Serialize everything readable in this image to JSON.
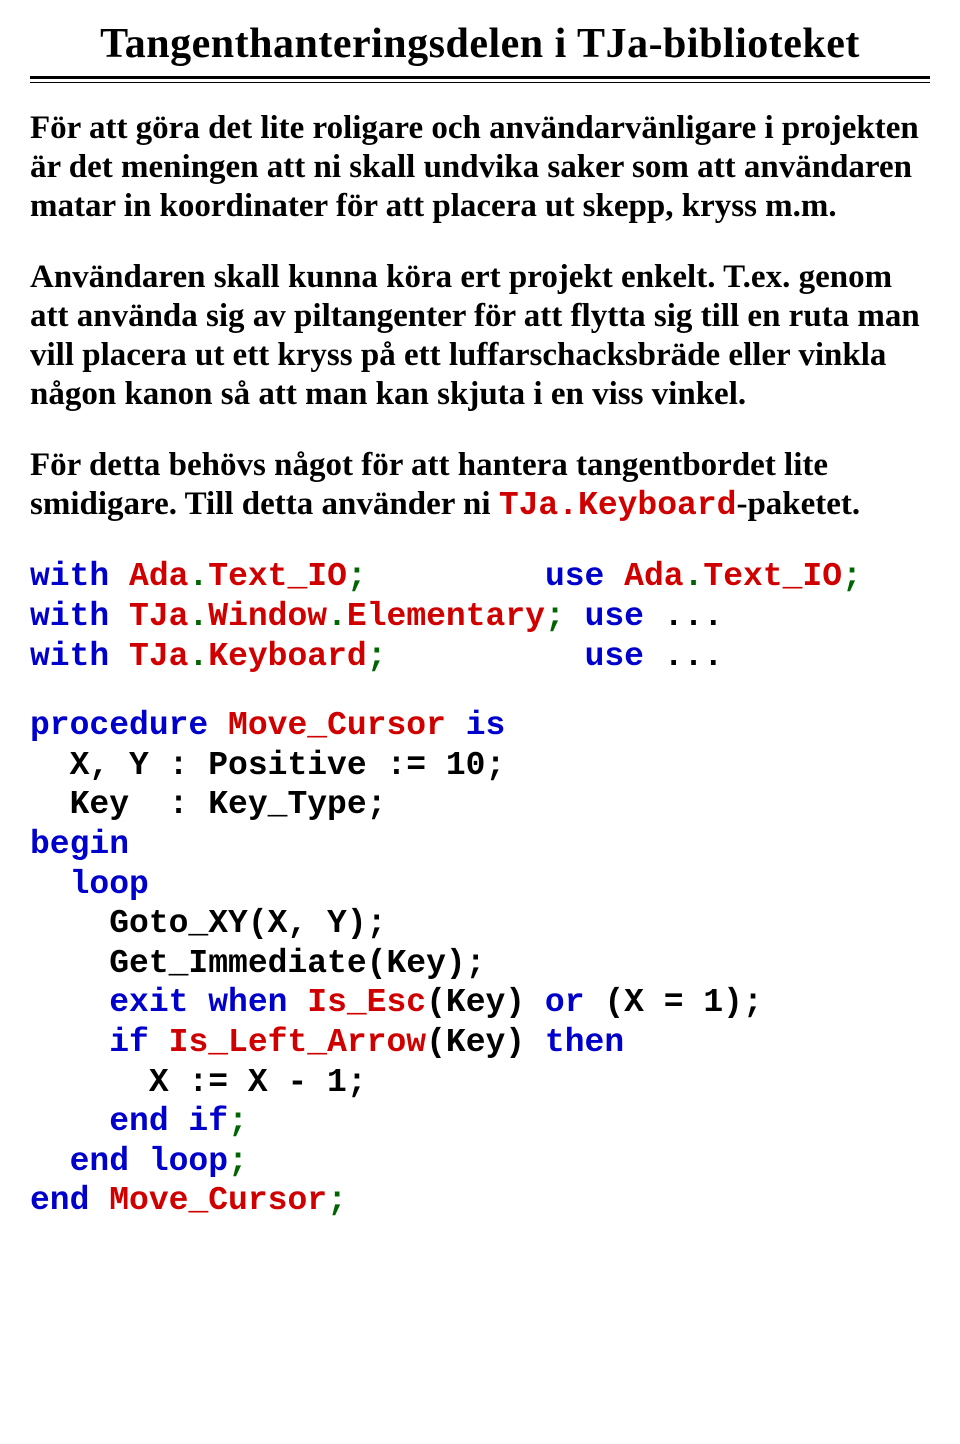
{
  "title": "Tangenthanteringsdelen i TJa-biblioteket",
  "para1": "För att göra det lite roligare och användarvänligare i projekten är det meningen att ni skall undvika saker som att användaren matar in koordinater för att placera ut skepp, kryss m.m.",
  "para2": "Användaren skall kunna köra ert projekt enkelt. T.ex. genom att använda sig av piltangenter för att flytta sig till en ruta man vill placera ut ett kryss på ett luffarschacks­bräde eller vinkla någon kanon så att man kan skjuta i en viss vinkel.",
  "para3_pre": "För detta behövs något för att hantera tangentbordet lite smidigare. Till detta använder ni ",
  "para3_code": "TJa.Keyboard",
  "para3_post": "-paketet.",
  "with1": {
    "kw1": "with",
    "pkg1a": "Ada",
    "dot1a": ".",
    "pkg1b": "Text_IO",
    "sc1": ";",
    "pad1": "         ",
    "kw2": "use",
    "pkg2a": "Ada",
    "dot2a": ".",
    "pkg2b": "Text_IO",
    "sc2": ";"
  },
  "with2": {
    "kw1": "with",
    "pkg1a": "TJa",
    "dot1a": ".",
    "pkg1b": "Window",
    "dot1b": ".",
    "pkg1c": "Elementary",
    "sc1": ";",
    "pad1": " ",
    "kw2": "use",
    "rest": " ..."
  },
  "with3": {
    "kw1": "with",
    "pkg1a": "TJa",
    "dot1a": ".",
    "pkg1b": "Keyboard",
    "sc1": ";",
    "pad1": "          ",
    "kw2": "use",
    "rest": " ..."
  },
  "proc": {
    "l1": {
      "kw": "procedure",
      "sp": " ",
      "name": "Move_Cursor",
      "sp2": " ",
      "kw2": "is"
    },
    "l2": "  X, Y : Positive := 10;",
    "l3": "  Key  : Key_Type;",
    "l4": "begin",
    "l5": "  loop",
    "l6": "    Goto_XY(X, Y);",
    "l7": "    Get_Immediate(Key);",
    "l8": {
      "pre": "    ",
      "kw1": "exit when",
      "sp1": " ",
      "fn": "Is_Esc",
      "args": "(Key) ",
      "kw2": "or",
      "sp2": " ",
      "rest": "(X = 1);"
    },
    "l9": {
      "pre": "    ",
      "kw1": "if",
      "sp1": " ",
      "fn": "Is_Left_Arrow",
      "args": "(Key) ",
      "kw2": "then"
    },
    "l10": "      X := X - 1;",
    "l11": {
      "pre": "    ",
      "kw": "end if",
      "sc": ";"
    },
    "l12": {
      "pre": "  ",
      "kw": "end loop",
      "sc": ";"
    },
    "l13": {
      "kw": "end",
      "sp": " ",
      "name": "Move_Cursor",
      "sc": ";"
    }
  }
}
